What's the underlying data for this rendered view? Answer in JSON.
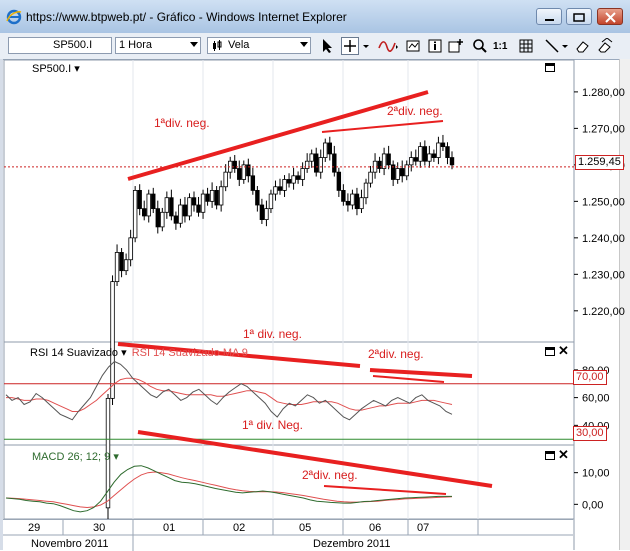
{
  "window": {
    "title": "https://www.btpweb.pt/ - Gráfico - Windows Internet Explorer"
  },
  "toolbar": {
    "symbol": "SP500.I",
    "interval": "1 Hora",
    "chart_style": "Vela",
    "ratio_label": "1:1"
  },
  "panels": {
    "price": {
      "title": "SP500.I",
      "last_price": "1.259,45"
    },
    "rsi": {
      "title": "RSI 14 Suavizado",
      "title2": "RSI 14 Suavizado MA 9",
      "upper": "70,00",
      "lower": "30,00"
    },
    "macd": {
      "title": "MACD 26; 12; 9"
    }
  },
  "annotations": {
    "price_div1": "1ªdiv. neg.",
    "price_div2": "2ªdiv. neg.",
    "rsi_div1": "1ª div. neg.",
    "rsi_div2": "2ªdiv. neg.",
    "macd_div1": "1ª div. Neg.",
    "macd_div2": "2ªdiv. neg."
  },
  "colors": {
    "annotation": "#d81e1e",
    "up": "#ffffff",
    "down": "#000000",
    "rsi": "#555555",
    "rsi_ma": "#e05050",
    "macd": "#2e6b2e",
    "signal": "#e05050"
  },
  "chart_data": [
    {
      "type": "candlestick",
      "title": "SP500.I",
      "yticks": [
        "1.280,00",
        "1.270,00",
        "1.260,00",
        "1.250,00",
        "1.240,00",
        "1.230,00",
        "1.220,00"
      ],
      "ylim": [
        1212,
        1286
      ],
      "last": 1259.45,
      "close": [
        1196,
        1228,
        1236,
        1231,
        1234,
        1240,
        1253,
        1248,
        1246,
        1252,
        1248,
        1243,
        1247,
        1251,
        1246,
        1244,
        1249,
        1246,
        1251,
        1249,
        1247,
        1252,
        1250,
        1253,
        1249,
        1254,
        1258,
        1261,
        1259,
        1256,
        1260,
        1257,
        1253,
        1249,
        1245,
        1248,
        1252,
        1254,
        1253,
        1256,
        1255,
        1257,
        1256,
        1259,
        1261,
        1263,
        1258,
        1262,
        1266,
        1263,
        1258,
        1253,
        1250,
        1249,
        1252,
        1248,
        1251,
        1255,
        1258,
        1261,
        1259,
        1263,
        1260,
        1256,
        1259,
        1257,
        1260,
        1262,
        1261,
        1265,
        1261,
        1263,
        1262,
        1266,
        1265,
        1262,
        1260
      ],
      "grid": true,
      "legend": "none"
    },
    {
      "type": "line",
      "title": "RSI 14 Suavizado",
      "yticks": [
        "80,00",
        "60,00",
        "40,00"
      ],
      "ylim": [
        28,
        90
      ],
      "levels": [
        70,
        30
      ],
      "series": [
        {
          "name": "RSI 14 Suavizado",
          "values": [
            62,
            58,
            60,
            55,
            57,
            63,
            60,
            56,
            52,
            48,
            46,
            44,
            50,
            55,
            60,
            68,
            76,
            82,
            86,
            84,
            80,
            74,
            70,
            66,
            62,
            60,
            64,
            66,
            62,
            58,
            60,
            64,
            66,
            62,
            58,
            55,
            60,
            64,
            67,
            70,
            68,
            64,
            60,
            56,
            50,
            46,
            52,
            56,
            54,
            58,
            62,
            60,
            56,
            58,
            54,
            50,
            46,
            44,
            48,
            52,
            55,
            58,
            56,
            54,
            58,
            60,
            58,
            56,
            60,
            62,
            58,
            56,
            54,
            50,
            48
          ]
        },
        {
          "name": "MA 9",
          "values": [
            60,
            60,
            59,
            58,
            58,
            59,
            59,
            58,
            56,
            54,
            52,
            50,
            50,
            52,
            55,
            58,
            62,
            66,
            70,
            73,
            74,
            74,
            73,
            71,
            68,
            66,
            65,
            65,
            64,
            63,
            62,
            62,
            62,
            62,
            62,
            61,
            61,
            62,
            63,
            64,
            65,
            65,
            64,
            63,
            60,
            57,
            56,
            55,
            55,
            55,
            56,
            57,
            57,
            57,
            57,
            56,
            54,
            52,
            51,
            51,
            52,
            53,
            54,
            54,
            55,
            56,
            56,
            56,
            57,
            58,
            58,
            58,
            57,
            56,
            55
          ]
        }
      ],
      "grid": false,
      "legend": "top-left"
    },
    {
      "type": "line",
      "title": "MACD 26; 12; 9",
      "yticks": [
        "10,00",
        "0,00"
      ],
      "ylim": [
        -4,
        14
      ],
      "series": [
        {
          "name": "MACD",
          "values": [
            2.0,
            1.8,
            1.6,
            1.2,
            1.0,
            0.8,
            0.4,
            0.2,
            -0.4,
            -1.2,
            -2.0,
            -2.4,
            -2.0,
            -1.0,
            1.0,
            4.0,
            7.0,
            9.5,
            11.0,
            12.0,
            12.2,
            11.5,
            10.5,
            9.5,
            8.5,
            7.5,
            7.0,
            6.8,
            6.5,
            6.0,
            5.5,
            5.0,
            4.6,
            4.2,
            3.8,
            3.6,
            3.8,
            4.0,
            4.2,
            4.0,
            3.6,
            3.2,
            2.8,
            2.4,
            2.0,
            1.4,
            1.0,
            0.8,
            0.6,
            0.5,
            0.4,
            0.4,
            0.6,
            0.9,
            1.0,
            1.2,
            1.4,
            1.6,
            1.8,
            2.0,
            2.1,
            2.2,
            2.3,
            2.4,
            2.5,
            2.5,
            2.5
          ]
        },
        {
          "name": "Signal",
          "values": [
            2.0,
            1.9,
            1.8,
            1.6,
            1.4,
            1.2,
            1.0,
            0.8,
            0.4,
            0.0,
            -0.4,
            -0.8,
            -1.0,
            -0.8,
            -0.2,
            1.0,
            2.8,
            4.6,
            6.4,
            8.0,
            9.3,
            10.0,
            10.2,
            10.0,
            9.6,
            9.0,
            8.4,
            7.9,
            7.5,
            7.0,
            6.5,
            6.0,
            5.5,
            5.0,
            4.6,
            4.3,
            4.1,
            4.0,
            4.0,
            4.0,
            3.9,
            3.7,
            3.4,
            3.1,
            2.8,
            2.4,
            2.0,
            1.6,
            1.3,
            1.0,
            0.8,
            0.7,
            0.7,
            0.8,
            0.9,
            1.0,
            1.2,
            1.4,
            1.5,
            1.7,
            1.8,
            1.9,
            2.0,
            2.1,
            2.2,
            2.3,
            2.4
          ]
        }
      ],
      "grid": false,
      "legend": "top-left"
    }
  ],
  "xaxis": {
    "day_labels": [
      "29",
      "30",
      "01",
      "02",
      "05",
      "06",
      "07"
    ],
    "month_labels": [
      "Novembro 2011",
      "Dezembro 2011"
    ]
  }
}
